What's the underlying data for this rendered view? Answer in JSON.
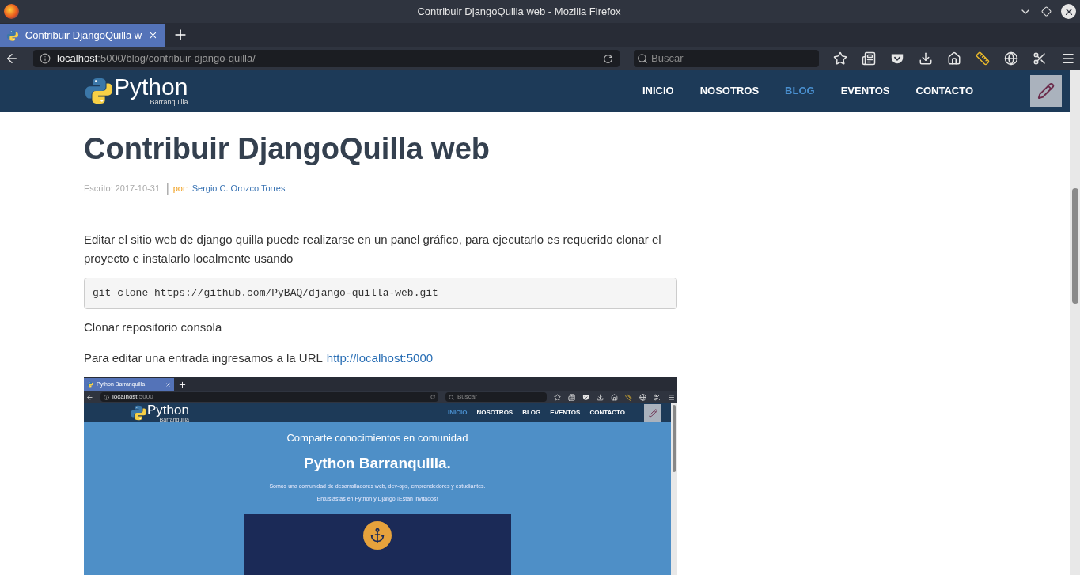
{
  "window": {
    "title": "Contribuir DjangoQuilla web - Mozilla Firefox"
  },
  "tab": {
    "title": "Contribuir DjangoQuilla w"
  },
  "address": {
    "host": "localhost",
    "path": ":5000/blog/contribuir-django-quilla/"
  },
  "search": {
    "placeholder": "Buscar"
  },
  "site": {
    "logo": "Python",
    "logo_sub": "Barranquilla",
    "nav": [
      {
        "label": "INICIO",
        "selected": false
      },
      {
        "label": "NOSOTROS",
        "selected": false
      },
      {
        "label": "BLOG",
        "selected": true
      },
      {
        "label": "EVENTOS",
        "selected": false
      },
      {
        "label": "CONTACTO",
        "selected": false
      }
    ]
  },
  "article": {
    "title": "Contribuir DjangoQuilla web",
    "written": "Escrito: 2017-10-31.",
    "separator": "|",
    "by": "por:",
    "author": "Sergio C. Orozco Torres",
    "paragraph": "Editar el sitio web de django quilla puede realizarse en un panel gráfico, para ejecutarlo es requerido clonar el proyecto e instalarlo localmente usando",
    "code": "git clone https://github.com/PyBAQ/django-quilla-web.git",
    "caption": "Clonar repositorio consola",
    "url_text": "Para editar una entrada ingresamos a la URL",
    "url_link": "http://localhost:5000"
  },
  "embedded": {
    "tab": {
      "title": "Python Barranquilla"
    },
    "address": {
      "host": "localhost",
      "path": ":5000"
    },
    "search": {
      "placeholder": "Buscar"
    },
    "logo": "Python",
    "logo_sub": "Barranquilla",
    "nav": [
      {
        "label": "INICIO",
        "selected": true
      },
      {
        "label": "NOSOTROS",
        "selected": false
      },
      {
        "label": "BLOG",
        "selected": false
      },
      {
        "label": "EVENTOS",
        "selected": false
      },
      {
        "label": "CONTACTO",
        "selected": false
      }
    ],
    "tagline": "Comparte conocimientos en comunidad",
    "heading": "Python Barranquilla.",
    "description": [
      "Somos una comunidad de desarrolladores web, dev-ops, emprendedores y estudiantes.",
      "Entusiastas en Python y Django ¡Están invitados!"
    ]
  }
}
